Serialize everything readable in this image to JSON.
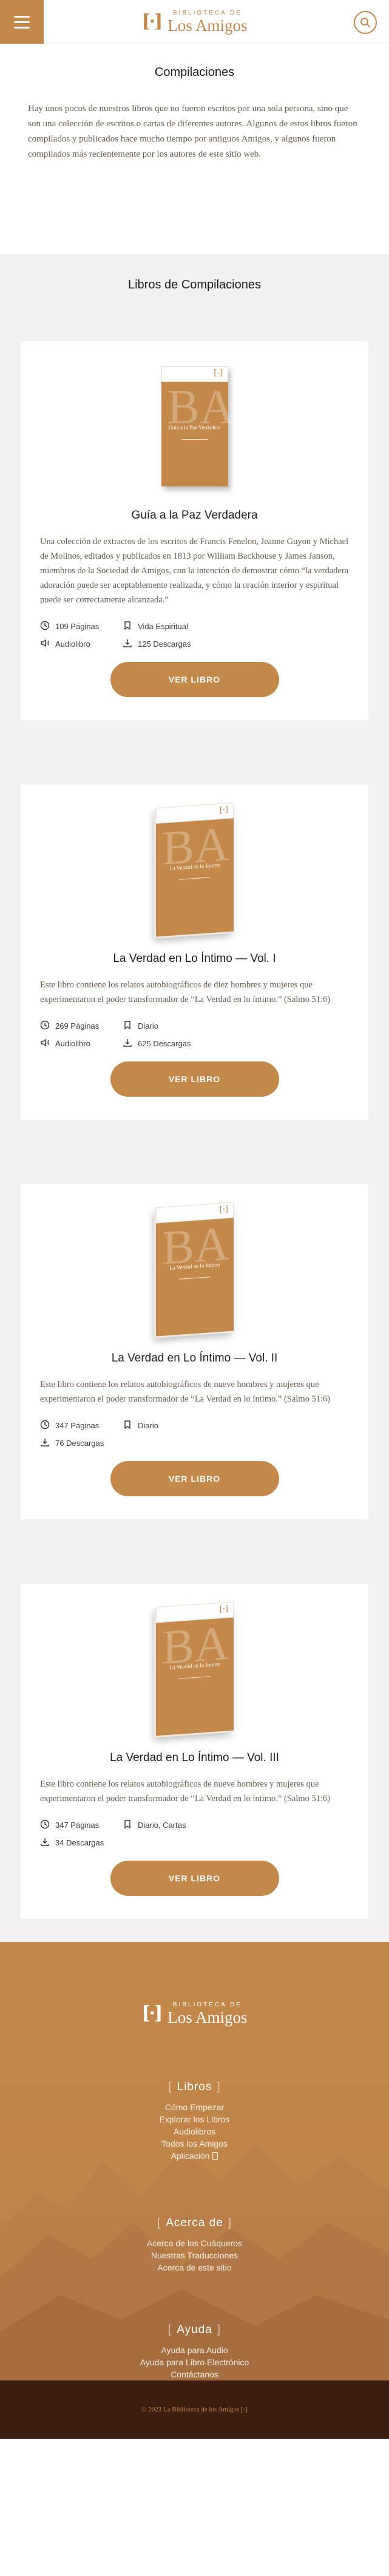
{
  "header": {
    "logo_top": "BIBLIOTECA DE",
    "logo_main": "Los Amigos",
    "logo_mark": "[·]",
    "icons": {
      "menu": "hamburger-icon",
      "search": "search-icon"
    }
  },
  "intro": {
    "title": "Compilaciones",
    "text": "Hay unos pocos de nuestros libros que no fueron escritos por una sola persona, sino que son una colección de escritos o cartas de diferentes autores. Algunos de estos libros fueron compilados y publicados hace mucho tiempo por antiguos Amigos, y algunos fueron compilados más recientemente por los autores de este sitio web."
  },
  "section_title": "Libros de Compilaciones",
  "cover": {
    "mark": "[·]",
    "letters": "BA",
    "titles": [
      "Guía a la Paz Verdadera",
      "La Verdad en lo Íntimo",
      "La Verdad en lo Íntimo",
      "La Verdad en lo Íntimo"
    ]
  },
  "books": [
    {
      "title": "Guía a la Paz Verdadera",
      "description": "Una colección de extractos de los escritos de Francis Fenelon, Jeanne Guyon y Michael de Molinos, editados y publicados en 1813 por William Backhouse y James Janson, miembros de la Sociedad de Amigos, con la intención de demostrar cómo “la verdadera adoración puede ser aceptablemente realizada, y cómo la oración interior y espiritual puede ser correctamente alcanzada.”",
      "pages": "109 Páginas",
      "category": "Vida Espiritual",
      "audio": "Audiolibro",
      "downloads": "125 Descargas",
      "button": "VER LIBRO"
    },
    {
      "title": "La Verdad en Lo Íntimo — Vol. I",
      "description": "Este libro contiene los relatos autobiográficos de diez hombres y mujeres que experimentaron el poder transformador de “La Verdad en lo íntimo.” (Salmo 51:6)",
      "pages": "269 Páginas",
      "category": "Diario",
      "audio": "Audiolibro",
      "downloads": "625 Descargas",
      "button": "VER LIBRO"
    },
    {
      "title": "La Verdad en Lo Íntimo — Vol. II",
      "description": "Este libro contiene los relatos autobiográficos de nueve hombres y mujeres que experimentaron el poder transformador de “La Verdad en lo íntimo.” (Salmo 51:6)",
      "pages": "347 Páginas",
      "category": "Diario",
      "downloads": "76 Descargas",
      "button": "VER LIBRO"
    },
    {
      "title": "La Verdad en Lo Íntimo — Vol. III",
      "description": "Este libro contiene los relatos autobiográficos de nueve hombres y mujeres que experimentaron el poder transformador de “La Verdad en lo íntimo.” (Salmo 51:6)",
      "pages": "347 Páginas",
      "category": "Diario, Cartas",
      "downloads": "34 Descargas",
      "button": "VER LIBRO"
    }
  ],
  "footer": {
    "logo_top": "BIBLIOTECA DE",
    "logo_main": "Los Amigos",
    "logo_mark": "[·]",
    "bracket_open": "[",
    "bracket_close": "]",
    "sections": [
      {
        "title": "Libros",
        "links": [
          "Cómo Empezar",
          "Explorar los Libros",
          "Audiolibros",
          "Todos los Amigos",
          "Aplicación"
        ]
      },
      {
        "title": "Acerca de",
        "links": [
          "Acerca de los Cuáqueros",
          "Nuestras Traducciones",
          "Acerca de este sitio"
        ]
      },
      {
        "title": "Ayuda",
        "links": [
          "Ayuda para Audio",
          "Ayuda para Libro Electrónico",
          "Contáctanos"
        ]
      }
    ],
    "copyright": "© 2023 La Biblioteca de los Amigos [·]"
  }
}
